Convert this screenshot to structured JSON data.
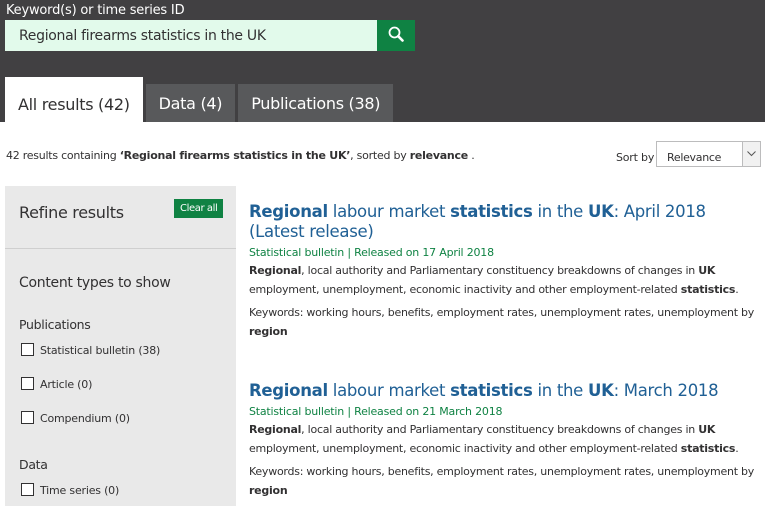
{
  "search": {
    "label": "Keyword(s) or time series ID",
    "value": "Regional firearms statistics in the UK",
    "button_icon": "search-icon"
  },
  "tabs": [
    {
      "label": "All results (42)",
      "active": true
    },
    {
      "label": "Data (4)",
      "active": false
    },
    {
      "label": "Publications (38)",
      "active": false
    }
  ],
  "summary": {
    "count_text": "42 results containing ",
    "query": "‘Regional firearms statistics in the UK’",
    "sorted_text": ", sorted by ",
    "sort_key": "relevance",
    "end": " ."
  },
  "sort": {
    "label": "Sort by",
    "selected": "Relevance",
    "arrow_icon": "chevron-down-icon"
  },
  "refine": {
    "title": "Refine results",
    "clear_label": "Clear all",
    "content_types_title": "Content types to show",
    "groups": [
      {
        "title": "Publications",
        "options": [
          {
            "label": "Statistical bulletin (38)",
            "checked": false
          },
          {
            "label": "Article (0)",
            "checked": false
          },
          {
            "label": "Compendium (0)",
            "checked": false
          }
        ]
      },
      {
        "title": "Data",
        "options": [
          {
            "label": "Time series (0)",
            "checked": false
          }
        ]
      }
    ]
  },
  "results": [
    {
      "title_parts": [
        {
          "text": "Regional",
          "bold": true
        },
        {
          "text": " labour market ",
          "bold": false
        },
        {
          "text": "statistics",
          "bold": true
        },
        {
          "text": " in the ",
          "bold": false
        },
        {
          "text": "UK",
          "bold": true
        },
        {
          "text": ": April 2018 (Latest release)",
          "bold": false
        }
      ],
      "meta": "Statistical bulletin | Released on 17 April 2018",
      "desc_parts": [
        {
          "text": "Regional",
          "bold": true
        },
        {
          "text": ", local authority and Parliamentary constituency breakdowns of changes in ",
          "bold": false
        },
        {
          "text": "UK",
          "bold": true
        },
        {
          "text": " employment, unemployment, economic inactivity and other employment-related ",
          "bold": false
        },
        {
          "text": "statistics",
          "bold": true
        },
        {
          "text": ".",
          "bold": false
        }
      ],
      "keywords_parts": [
        {
          "text": "Keywords: working hours, benefits, employment rates, unemployment rates, unemployment by ",
          "bold": false
        },
        {
          "text": "region",
          "bold": true
        }
      ]
    },
    {
      "title_parts": [
        {
          "text": "Regional",
          "bold": true
        },
        {
          "text": " labour market ",
          "bold": false
        },
        {
          "text": "statistics",
          "bold": true
        },
        {
          "text": " in the ",
          "bold": false
        },
        {
          "text": "UK",
          "bold": true
        },
        {
          "text": ": March 2018",
          "bold": false
        }
      ],
      "meta": "Statistical bulletin | Released on 21 March 2018",
      "desc_parts": [
        {
          "text": "Regional",
          "bold": true
        },
        {
          "text": ", local authority and Parliamentary constituency breakdowns of changes in ",
          "bold": false
        },
        {
          "text": "UK",
          "bold": true
        },
        {
          "text": " employment, unemployment, economic inactivity and other employment-related ",
          "bold": false
        },
        {
          "text": "statistics",
          "bold": true
        },
        {
          "text": ".",
          "bold": false
        }
      ],
      "keywords_parts": [
        {
          "text": "Keywords: working hours, benefits, employment rates, unemployment rates, unemployment by ",
          "bold": false
        },
        {
          "text": "region",
          "bold": true
        }
      ]
    }
  ],
  "colors": {
    "header_bg": "#414042",
    "tab_bg": "#58595b",
    "accent_green": "#0f8243",
    "search_bg": "#e2faeb",
    "link_blue": "#206095",
    "panel_bg": "#e9e9e9"
  }
}
